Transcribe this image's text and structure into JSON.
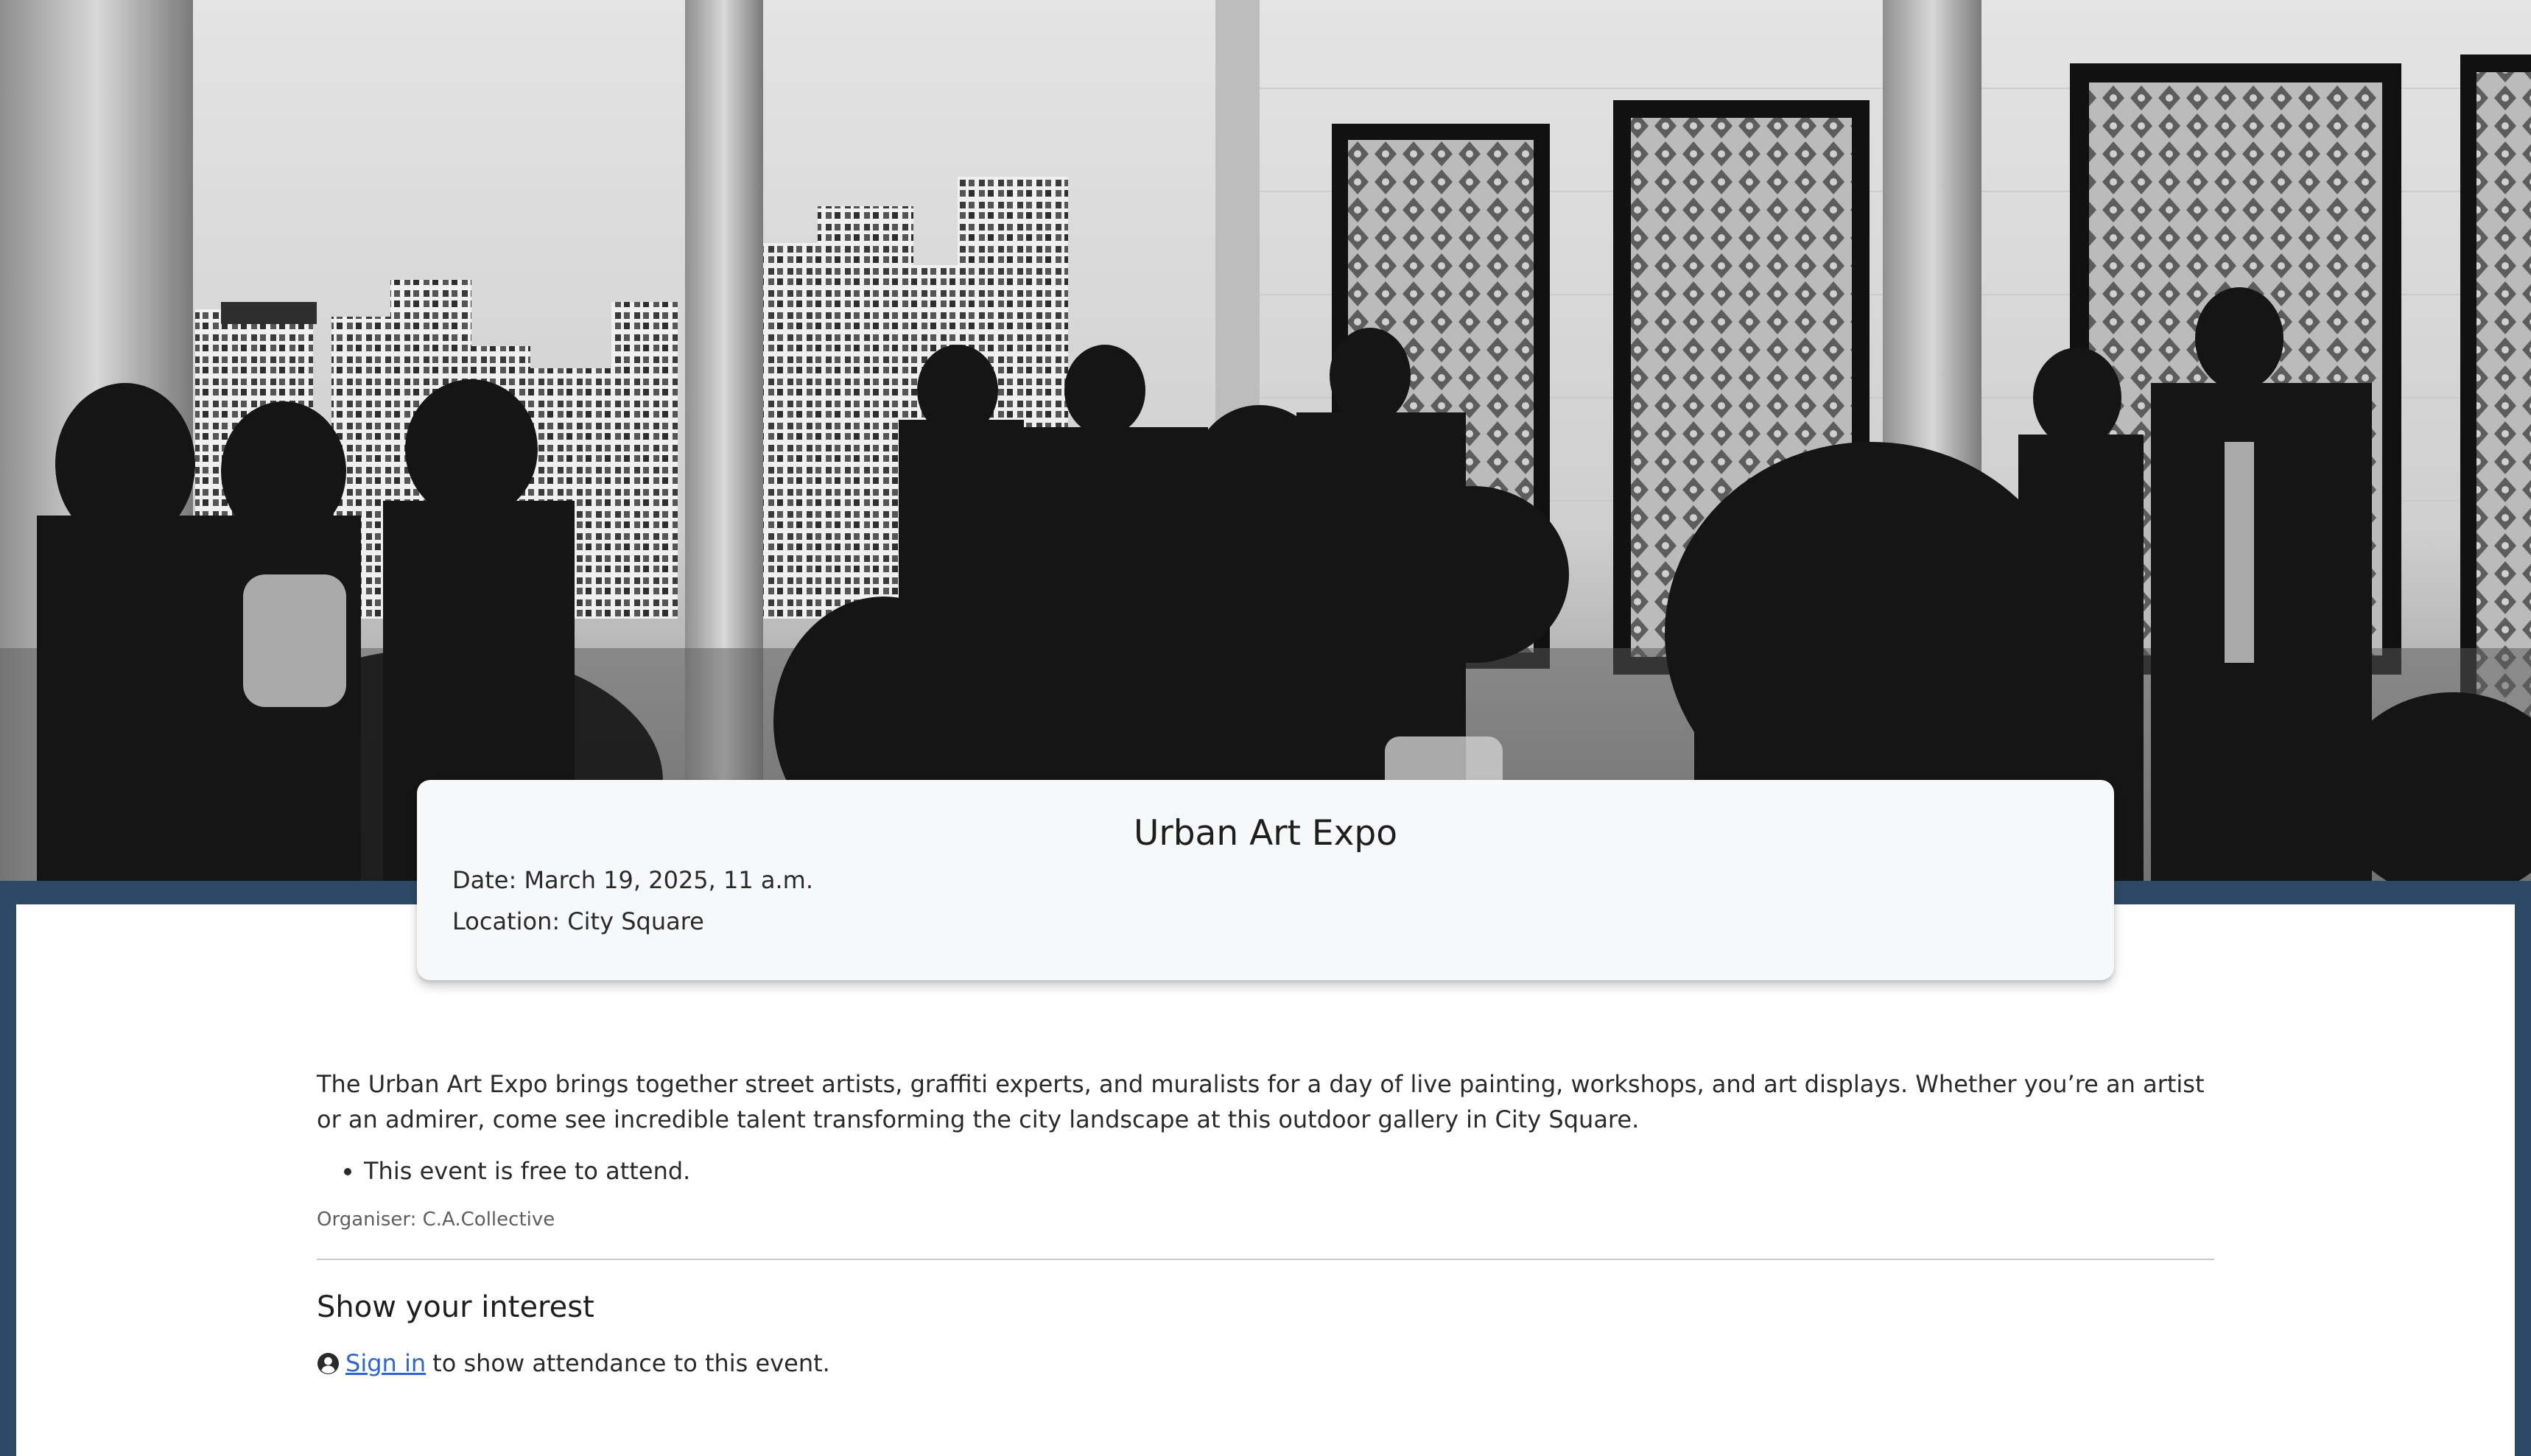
{
  "hero": {
    "image_description_icon": "gallery-photo"
  },
  "event": {
    "title": "Urban Art Expo",
    "date_line": "Date: March 19, 2025, 11 a.m.",
    "location_line": "Location: City Square"
  },
  "details": {
    "description": "The Urban Art Expo brings together street artists, graffiti experts, and muralists for a day of live painting, workshops, and art displays. Whether you’re an artist or an admirer, come see incredible talent transforming the city landscape at this outdoor gallery in City Square.",
    "bullets": [
      "This event is free to attend."
    ],
    "organiser": "Organiser: C.A.Collective"
  },
  "interest": {
    "heading": "Show your interest",
    "user_icon": "user-circle-icon",
    "signin_label": "Sign in",
    "signin_suffix": "to show attendance to this event."
  },
  "colors": {
    "page_border": "#2c4a66",
    "link": "#2f66d0",
    "card_bg": "#f7f8fa"
  }
}
